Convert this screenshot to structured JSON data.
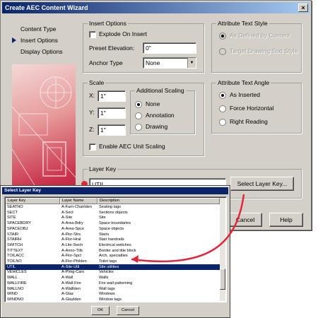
{
  "window": {
    "title": "Create AEC Content Wizard",
    "close": "×"
  },
  "nav": [
    "Content Type",
    "Insert Options",
    "Display Options"
  ],
  "insert_options": {
    "title": "Insert Options",
    "explode": "Explode On Insert",
    "elevation_label": "Preset Elevation:",
    "elevation_value": "0\"",
    "anchor_label": "Anchor Type",
    "anchor_value": "None"
  },
  "attr_style": {
    "title": "Attribute Text Style",
    "opt1": "As Defined by Content",
    "opt2": "Target Drawing Text Style"
  },
  "scale": {
    "title": "Scale",
    "x_label": "X:",
    "x_value": "1\"",
    "y_label": "Y:",
    "y_value": "1\"",
    "z_label": "Z:",
    "z_value": "1\"",
    "add_title": "Additional Scaling",
    "none": "None",
    "annotation": "Annotation",
    "drawing": "Drawing",
    "enable": "Enable AEC Unit Scaling"
  },
  "attr_angle": {
    "title": "Attribute Text Angle",
    "as_inserted": "As Inserted",
    "force_h": "Force Horizontal",
    "right_read": "Right Reading"
  },
  "layer_key": {
    "title": "Layer Key",
    "value": "UTIL",
    "button": "Select Layer Key..."
  },
  "footer": {
    "cancel": "Cancel",
    "help": "Help"
  },
  "popup": {
    "title": "Select Layer Key",
    "columns": [
      "Layer Key",
      "Layer Name",
      "Description"
    ],
    "rows": [
      [
        "SEATNO",
        "A-Furn-Chairlden",
        "Seating tags"
      ],
      [
        "SECT",
        "A-Sect",
        "Sections objects"
      ],
      [
        "SITE",
        "A-Site",
        "Site"
      ],
      [
        "SPACEBDRY",
        "A-Area-Bdry",
        "Space boundaries"
      ],
      [
        "SPACEOBJ",
        "A-Area-Spce",
        "Space objects"
      ],
      [
        "STAIR",
        "A-Flor-Strs",
        "Stairs"
      ],
      [
        "STAIRH",
        "A-Flor-Hral",
        "Stair handrails"
      ],
      [
        "SWITCH",
        "A-Lite-Swch",
        "Electrical switches"
      ],
      [
        "TITTEXT",
        "A-Anno-Ttlb",
        "Border and title block"
      ],
      [
        "TOILACC",
        "A-Flor-Spcl",
        "Arch. specialties"
      ],
      [
        "TOILNO",
        "A-Flor-Pfxlden",
        "Toilet tags"
      ],
      [
        "UTIL",
        "A-Site-Util",
        "Site utilities"
      ],
      [
        "VEHICLES",
        "A-Plmg-Cars",
        "Vehicles"
      ],
      [
        "WALL",
        "A-Wall",
        "Walls"
      ],
      [
        "WALLFIRE",
        "A-Wall-Fire",
        "Fire wall patterning"
      ],
      [
        "WALLNO",
        "A-Walllden",
        "Wall tags"
      ],
      [
        "WIND",
        "A-Glaz",
        "Windows"
      ],
      [
        "WINDNO",
        "A-Glazlden",
        "Window tags"
      ]
    ],
    "ok": "OK",
    "cancel": "Cancel"
  },
  "colors": {
    "accent": "#0a246a",
    "arrow": "#e0283c"
  }
}
